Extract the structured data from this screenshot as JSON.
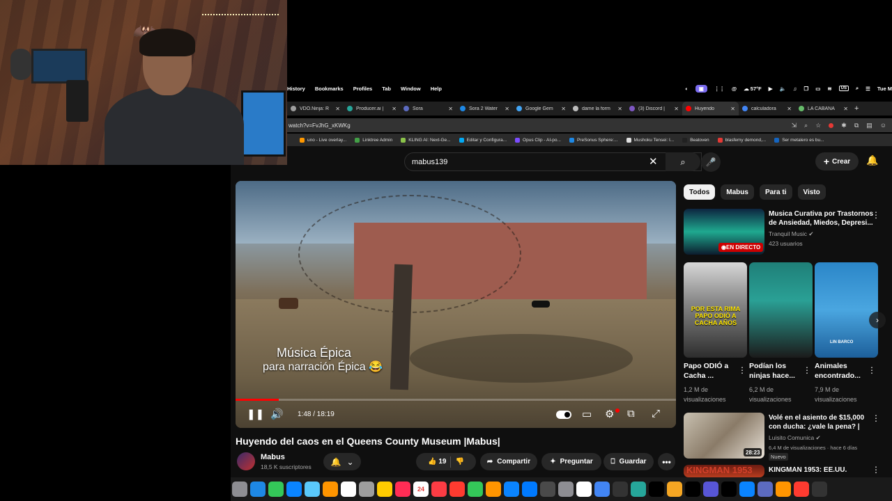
{
  "menubar": {
    "items": [
      "History",
      "Bookmarks",
      "Profiles",
      "Tab",
      "Window",
      "Help"
    ],
    "temperature": "57°F",
    "input_lang": "US",
    "clock": "Tue M"
  },
  "tabs": [
    {
      "title": "VDO.Ninja: R",
      "color": "#9e9e9e"
    },
    {
      "title": "Producer.ai |",
      "color": "#26a69a"
    },
    {
      "title": "Sora",
      "color": "#5c6bc0"
    },
    {
      "title": "Sora 2 Water",
      "color": "#1e88e5"
    },
    {
      "title": "Google Gem",
      "color": "#42a5f5"
    },
    {
      "title": "dame la form",
      "color": "#bdbdbd"
    },
    {
      "title": "(3) Discord |",
      "color": "#7e57c2"
    },
    {
      "title": "Huyendo",
      "color": "#ff0000",
      "active": true
    },
    {
      "title": "calculadora",
      "color": "#4285f4"
    },
    {
      "title": "LA CABAÑA",
      "color": "#66bb6a"
    }
  ],
  "address": {
    "url": "watch?v=FvJhG_xKWKg"
  },
  "bookmarks": [
    {
      "label": "uno - Live overlay...",
      "color": "#ff9800"
    },
    {
      "label": "Linktree Admin",
      "color": "#43a047"
    },
    {
      "label": "KLING AI: Next-Ge...",
      "color": "#8bc34a"
    },
    {
      "label": "Editar y Configura...",
      "color": "#03a9f4"
    },
    {
      "label": "Opus Clip - AI-po...",
      "color": "#7c4dff"
    },
    {
      "label": "PreSonus Sphere:...",
      "color": "#1e88e5"
    },
    {
      "label": "Mushoku Tensei: I...",
      "color": "#e0e0e0"
    },
    {
      "label": "Beatoven",
      "color": "#212121"
    },
    {
      "label": "blasfemy demond,...",
      "color": "#e53935"
    },
    {
      "label": "Ser metalero es bu...",
      "color": "#1565c0"
    }
  ],
  "youtube": {
    "search_value": "mabus139",
    "create_label": "Crear",
    "video": {
      "caption_line1": "Música Épica",
      "caption_line2": "para narración Épica 😂",
      "time": "1:48 / 18:19",
      "progress": 0.098
    },
    "title": "Huyendo del caos en el Queens County Museum |Mabus|",
    "channel": {
      "name": "Mabus",
      "subs": "18,5 K suscriptores"
    },
    "actions": {
      "likes": "19",
      "share": "Compartir",
      "ask": "Preguntar",
      "save": "Guardar"
    },
    "chips": [
      "Todos",
      "Mabus",
      "Para ti",
      "Visto"
    ],
    "rec1": {
      "title_l1": "Musica Curativa por Trastornos",
      "title_l2": "de Ansiedad, Miedos, Depresi...",
      "channel": "Tranquil Music ✔",
      "viewers": "423 usuarios",
      "live": "EN DIRECTO"
    },
    "shorts": [
      {
        "title_l1": "Papo ODIÓ a",
        "title_l2": "Cacha ...",
        "views_l1": "1,2 M de",
        "views_l2": "visualizaciones",
        "overlay": "POR ESTA RIMA PAPO ODIÓ A CACHA AÑOS"
      },
      {
        "title_l1": "Podían los",
        "title_l2": "ninjas hace...",
        "views_l1": "6,2 M de",
        "views_l2": "visualizaciones",
        "overlay": ""
      },
      {
        "title_l1": "Animales",
        "title_l2": "encontrado...",
        "views_l1": "7,9 M de",
        "views_l2": "visualizaciones",
        "overlay": "LIN BARCO"
      }
    ],
    "rec2": {
      "title_l1": "Volé en el asiento de $15,000",
      "title_l2": "con ducha: ¿vale la pena? |",
      "channel": "Luisito Comunica ✔",
      "meta": "6,4 M de visualizaciones · hace 6 días",
      "duration": "28:23",
      "badge": "Nuevo"
    },
    "rec3": {
      "title": "KINGMAN 1953: EE.UU.",
      "thumb_text": "KINGMAN 1953"
    }
  },
  "dock": {
    "calendar_day": "24"
  }
}
